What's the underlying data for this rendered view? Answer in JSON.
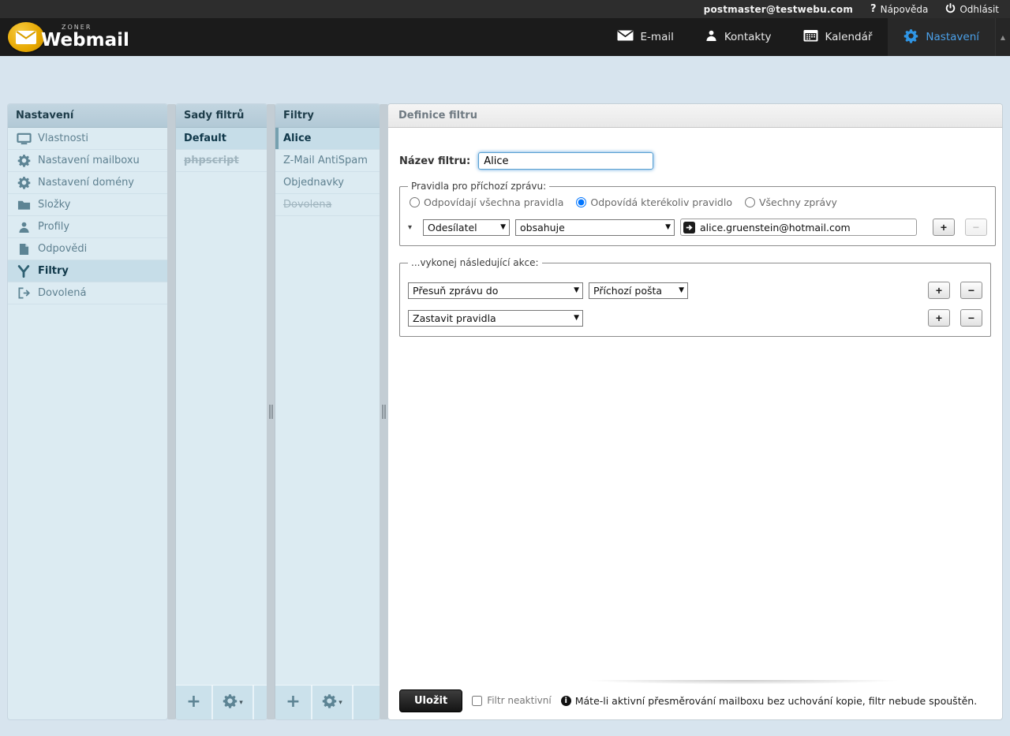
{
  "topbar": {
    "user": "postmaster@testwebu.com",
    "help_icon": "?",
    "help_label": "Nápověda",
    "logout_label": "Odhlásit"
  },
  "brand": {
    "super": "ZONER",
    "name": "Webmail"
  },
  "nav": {
    "items": [
      {
        "label": "E-mail",
        "icon": "envelope-icon",
        "active": false
      },
      {
        "label": "Kontakty",
        "icon": "person-icon",
        "active": false
      },
      {
        "label": "Kalendář",
        "icon": "calendar-icon",
        "active": false
      },
      {
        "label": "Nastavení",
        "icon": "gear-icon",
        "active": true
      }
    ],
    "collapse_icon": "▲"
  },
  "settings_menu": {
    "title": "Nastavení",
    "items": [
      {
        "label": "Vlastnosti",
        "icon": "monitor-icon",
        "active": false
      },
      {
        "label": "Nastavení mailboxu",
        "icon": "gear-icon",
        "active": false
      },
      {
        "label": "Nastavení domény",
        "icon": "gear-icon",
        "active": false
      },
      {
        "label": "Složky",
        "icon": "folder-icon",
        "active": false
      },
      {
        "label": "Profily",
        "icon": "person-icon",
        "active": false
      },
      {
        "label": "Odpovědi",
        "icon": "document-icon",
        "active": false
      },
      {
        "label": "Filtry",
        "icon": "filter-icon",
        "active": true
      },
      {
        "label": "Dovolená",
        "icon": "logout-door-icon",
        "active": false
      }
    ]
  },
  "filter_sets": {
    "title": "Sady filtrů",
    "items": [
      {
        "label": "Default",
        "selected": true,
        "disabled": false
      },
      {
        "label": "phpscript",
        "selected": false,
        "disabled": true
      }
    ]
  },
  "filters": {
    "title": "Filtry",
    "items": [
      {
        "label": "Alice",
        "selected": true,
        "disabled": false
      },
      {
        "label": "Z-Mail AntiSpam",
        "selected": false,
        "disabled": false
      },
      {
        "label": "Objednavky",
        "selected": false,
        "disabled": false
      },
      {
        "label": "Dovolena",
        "selected": false,
        "disabled": true
      }
    ]
  },
  "list_toolbar": {
    "add_icon": "+",
    "menu_icon": "gear-icon",
    "menu_caret": "▾"
  },
  "editor": {
    "title": "Definice filtru",
    "name_label": "Název filtru:",
    "name_value": "Alice",
    "rules": {
      "legend": "Pravidla pro příchozí zprávu:",
      "radios": [
        {
          "label": "Odpovídají všechna pravidla",
          "checked": false
        },
        {
          "label": "Odpovídá kterékoliv pravidlo",
          "checked": true
        },
        {
          "label": "Všechny zprávy",
          "checked": false
        }
      ],
      "row": {
        "field": "Odesílatel",
        "operator": "obsahuje",
        "value": "alice.gruenstein@hotmail.com"
      }
    },
    "actions": {
      "legend": "...vykonej následující akce:",
      "rows": [
        {
          "action": "Přesuň zprávu do",
          "target": "Příchozí pošta"
        },
        {
          "action": "Zastavit pravidla",
          "target": null
        }
      ]
    },
    "controls": {
      "add_label": "+",
      "remove_label": "−",
      "dropdown_arrow": "▼",
      "row_caret": "▾"
    },
    "footer": {
      "save_label": "Uložit",
      "inactive_label": "Filtr neaktivní",
      "inactive_checked": false,
      "info_icon": "i",
      "note": "Máte-li aktivní přesměrování mailboxu bez uchování kopie, filtr nebude spouštěn."
    }
  },
  "colors": {
    "accent_blue": "#4ba0e8",
    "column_header_bg": "#b8cdd9",
    "selected_item_bg": "#c6dde8",
    "topbar_bg": "#2d2d2d",
    "navbar_bg": "#1b1b1b",
    "brand_gold": "#e7a800"
  }
}
